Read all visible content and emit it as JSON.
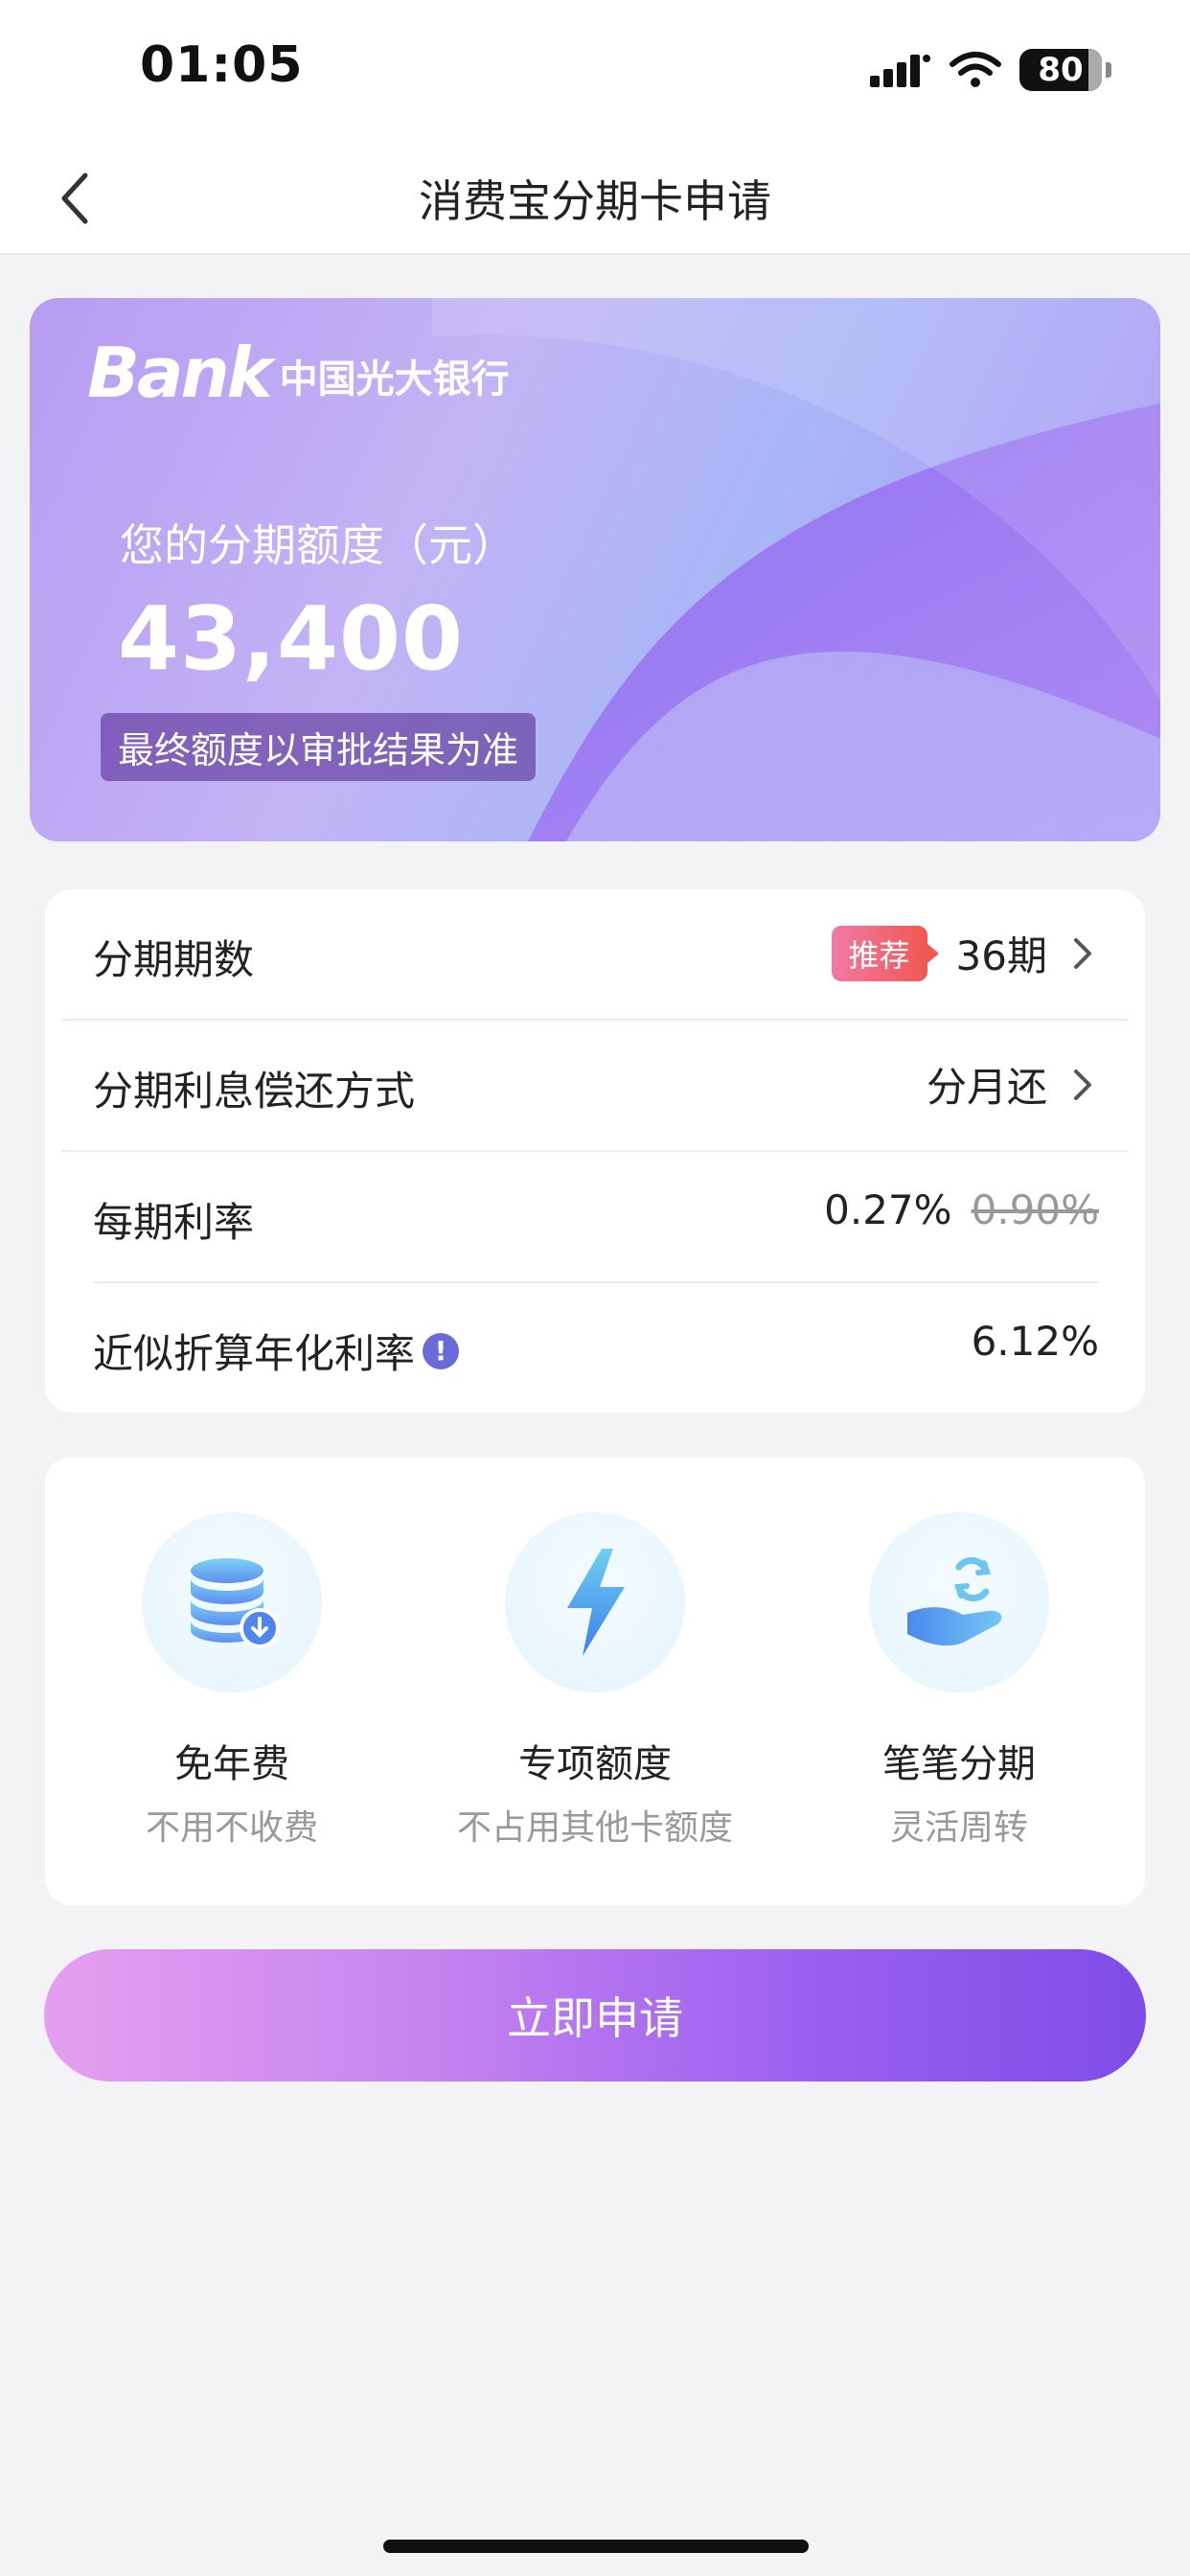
{
  "status_bar": {
    "time": "01:05",
    "battery": "80"
  },
  "nav": {
    "title": "消费宝分期卡申请"
  },
  "hero": {
    "brand_bank": "Bank",
    "brand_name": "中国光大银行",
    "label": "您的分期额度（元）",
    "amount": "43,400",
    "note": "最终额度以审批结果为准"
  },
  "info": {
    "rows": [
      {
        "label": "分期期数",
        "tag": "推荐",
        "value": "36期"
      },
      {
        "label": "分期利息偿还方式",
        "value": "分月还"
      },
      {
        "label": "每期利率",
        "value": "0.27%",
        "original": "0.90%"
      },
      {
        "label": "近似折算年化利率",
        "value": "6.12%"
      }
    ]
  },
  "features": [
    {
      "icon": "database-icon",
      "title": "免年费",
      "subtitle": "不用不收费"
    },
    {
      "icon": "lightning-icon",
      "title": "专项额度",
      "subtitle": "不占用其他卡额度"
    },
    {
      "icon": "hand-refresh-icon",
      "title": "笔笔分期",
      "subtitle": "灵活周转"
    }
  ],
  "apply_button": {
    "label": "立即申请"
  },
  "colors": {
    "accent": "#8a57ec",
    "tag": "#f0584f",
    "card": "#ffffff",
    "background": "#f3f3f6"
  }
}
